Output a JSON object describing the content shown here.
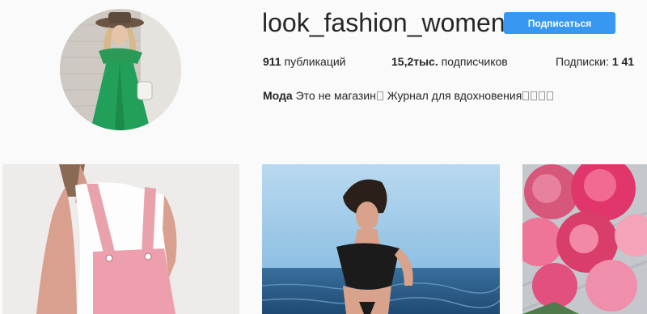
{
  "profile": {
    "username": "look_fashion_women",
    "follow_label": "Подписаться",
    "stats": {
      "posts_count": "911",
      "posts_label": "публикаций",
      "followers_count": "15,2тыс.",
      "followers_label": "подписчиков",
      "following_label": "Подписки:",
      "following_count": "1 41"
    },
    "bio": {
      "name": "Мода",
      "text_part1": "Это не магазин",
      "text_part2": "Журнал для вдохновения"
    }
  },
  "posts": [
    {
      "subject": "woman in pink denim overalls and white t-shirt"
    },
    {
      "subject": "woman in black off-shoulder top by the sea"
    },
    {
      "subject": "pink peonies bouquet"
    }
  ],
  "colors": {
    "accent": "#3897f0",
    "background": "#fafafa",
    "text": "#262626"
  }
}
